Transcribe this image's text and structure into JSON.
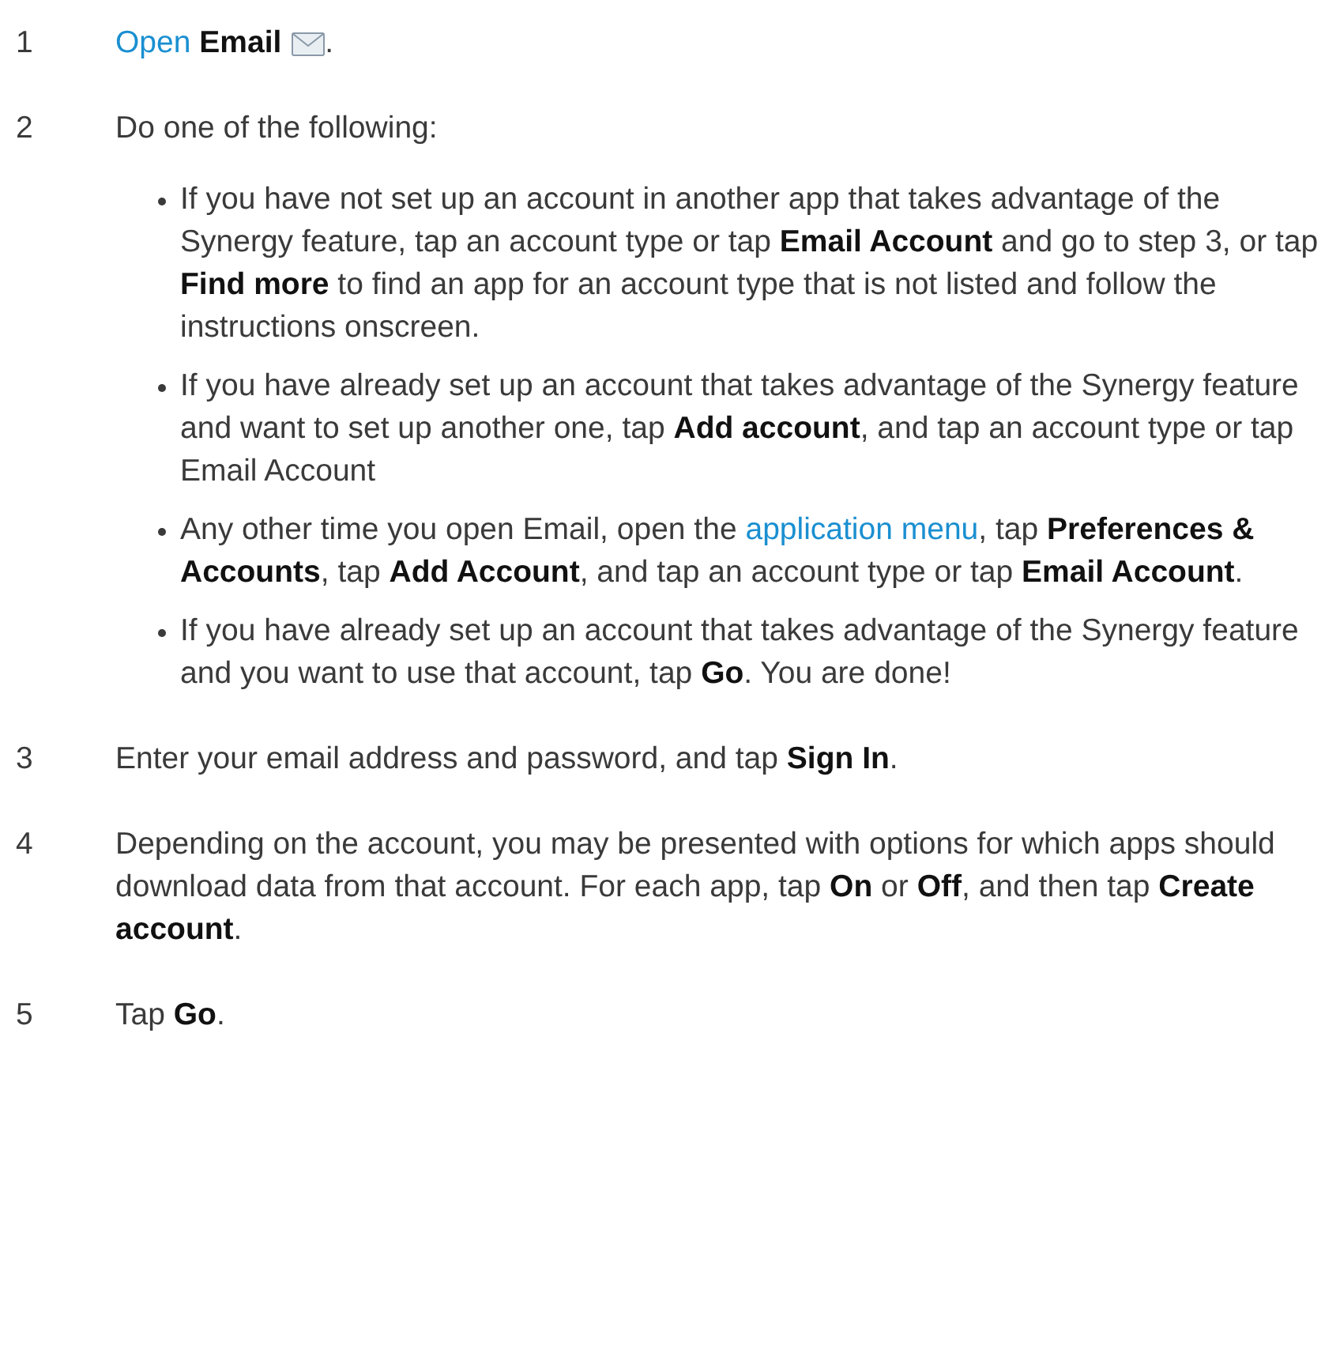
{
  "steps": [
    {
      "number": "1",
      "segments": [
        {
          "kind": "link",
          "text": "Open"
        },
        {
          "kind": "text",
          "text": " **Email** "
        },
        {
          "kind": "icon"
        },
        {
          "kind": "text",
          "text": "."
        }
      ]
    },
    {
      "number": "2",
      "segments": [
        {
          "kind": "text",
          "text": "Do one of the following:"
        }
      ],
      "bullets": [
        {
          "segments": [
            {
              "kind": "text",
              "text": "If you have not set up an account in another app that takes advantage of the Synergy feature, tap an account type or tap **Email Account** and go to step 3, or tap **Find more** to find an app for an account type that is not listed and follow the instructions onscreen."
            }
          ]
        },
        {
          "segments": [
            {
              "kind": "text",
              "text": "If you have already set up an account that takes advantage of the Synergy feature and want to set up another one, tap **Add account**, and tap an account type or tap Email Account"
            }
          ]
        },
        {
          "segments": [
            {
              "kind": "text",
              "text": "Any other time you open Email, open the "
            },
            {
              "kind": "link",
              "text": "application menu"
            },
            {
              "kind": "text",
              "text": ", tap **Preferences & Accounts**, tap **Add Account**, and tap an account type or tap **Email Account**."
            }
          ]
        },
        {
          "segments": [
            {
              "kind": "text",
              "text": "If you have already set up an account that takes advantage of the Synergy feature and you want to use that account, tap **Go**. You are done!"
            }
          ]
        }
      ]
    },
    {
      "number": "3",
      "segments": [
        {
          "kind": "text",
          "text": "Enter your email address and password, and tap **Sign In**."
        }
      ]
    },
    {
      "number": "4",
      "segments": [
        {
          "kind": "text",
          "text": "Depending on the account, you may be presented with options for which apps should download data from that account. For each app, tap **On** or **Off**, and then tap **Create account**."
        }
      ]
    },
    {
      "number": "5",
      "segments": [
        {
          "kind": "text",
          "text": "Tap **Go**."
        }
      ]
    }
  ]
}
